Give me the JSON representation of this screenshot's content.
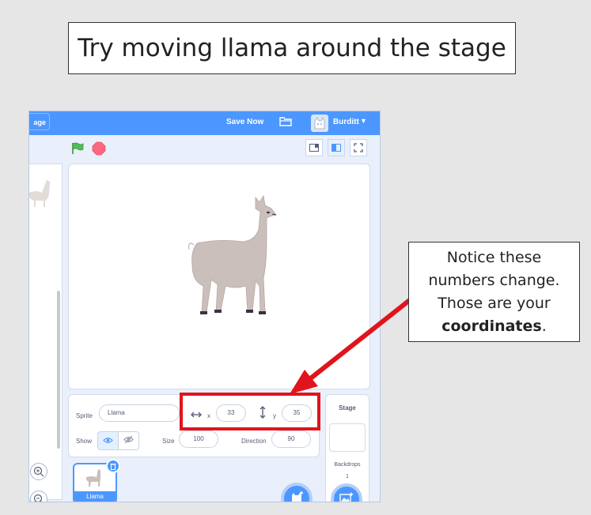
{
  "slide": {
    "title": "Try moving llama around the stage",
    "callout": {
      "line1": "Notice these",
      "line2": "numbers change.",
      "line3": "Those are your",
      "bold": "coordinates",
      "tail": "."
    }
  },
  "scratch": {
    "menubar": {
      "stage_tab": "age",
      "save_label": "Save Now",
      "username": "Burditt",
      "folder_icon": "folder-icon",
      "accent_color": "#4c97ff"
    },
    "controls": {
      "flag_icon": "green-flag-icon",
      "stop_icon": "stop-icon",
      "stop_color": "#ff6680"
    },
    "sprite_info": {
      "sprite_label": "Sprite",
      "sprite_name": "Llama",
      "x_label": "x",
      "x_value": "33",
      "y_label": "y",
      "y_value": "35",
      "show_label": "Show",
      "size_label": "Size",
      "size_value": "100",
      "direction_label": "Direction",
      "direction_value": "90"
    },
    "sprite_list": {
      "thumbnail_label": "Llama"
    },
    "stage_panel": {
      "title": "Stage",
      "backdrops_label": "Backdrops",
      "backdrops_count": "1"
    }
  },
  "annotation": {
    "highlight_color": "#e0141c"
  }
}
